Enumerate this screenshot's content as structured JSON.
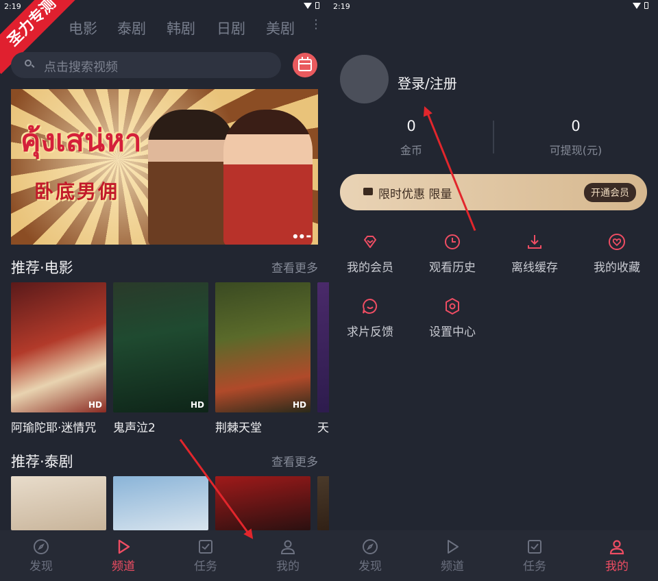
{
  "status": {
    "left_time": "2:19",
    "right_time": "2:19"
  },
  "watermark": "圣力专测",
  "left": {
    "tabs": [
      "电影",
      "泰剧",
      "韩剧",
      "日剧",
      "美剧"
    ],
    "more_icon": "⋮",
    "search": {
      "placeholder": "点击搜索视频"
    },
    "banner": {
      "thai_title": "คุ้งเสน่หา",
      "cn_title": "卧底男佣"
    },
    "sections": [
      {
        "title": "推荐·电影",
        "more": "查看更多",
        "items": [
          {
            "label": "阿瑜陀耶·迷情咒",
            "badge": "HD"
          },
          {
            "label": "鬼声泣2",
            "badge": "HD"
          },
          {
            "label": "荆棘天堂",
            "badge": "HD"
          },
          {
            "label": "天",
            "badge": ""
          }
        ]
      },
      {
        "title": "推荐·泰剧",
        "more": "查看更多"
      }
    ],
    "nav": [
      {
        "label": "发现",
        "icon": "compass-icon",
        "active": false
      },
      {
        "label": "频道",
        "icon": "play-icon",
        "active": true
      },
      {
        "label": "任务",
        "icon": "task-icon",
        "active": false
      },
      {
        "label": "我的",
        "icon": "user-icon",
        "active": false
      }
    ]
  },
  "right": {
    "login_label": "登录/注册",
    "stats": [
      {
        "value": "0",
        "label": "金币"
      },
      {
        "value": "0",
        "label": "可提现(元)"
      }
    ],
    "vip": {
      "text": "限时优惠 限量",
      "button": "开通会员"
    },
    "functions": [
      {
        "label": "我的会员",
        "icon": "diamond-icon"
      },
      {
        "label": "观看历史",
        "icon": "clock-icon"
      },
      {
        "label": "离线缓存",
        "icon": "download-icon"
      },
      {
        "label": "我的收藏",
        "icon": "heart-icon"
      },
      {
        "label": "求片反馈",
        "icon": "feedback-icon"
      },
      {
        "label": "设置中心",
        "icon": "settings-icon"
      }
    ],
    "nav": [
      {
        "label": "发现",
        "icon": "compass-icon",
        "active": false
      },
      {
        "label": "频道",
        "icon": "play-icon",
        "active": false
      },
      {
        "label": "任务",
        "icon": "task-icon",
        "active": false
      },
      {
        "label": "我的",
        "icon": "user-icon",
        "active": true
      }
    ]
  },
  "colors": {
    "accent": "#ef4d63",
    "background": "#222631",
    "vip_gold": "#e9d3b5"
  }
}
